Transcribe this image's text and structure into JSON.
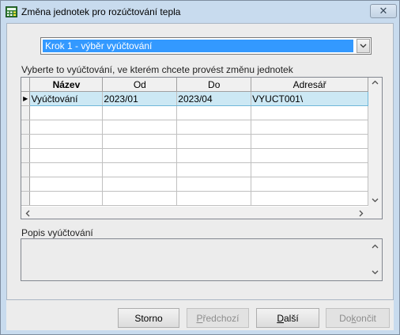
{
  "window": {
    "title": "Změna jednotek pro rozúčtování tepla",
    "close_symbol": "✕"
  },
  "step_combo": {
    "value": "Krok 1 - výběr vyúčtování",
    "arrow": "⌵"
  },
  "grid_label": "Vyberte to vyúčtování, ve kterém chcete provést změnu jednotek",
  "grid": {
    "columns": [
      "Název",
      "Od",
      "Do",
      "Adresář"
    ],
    "rows": [
      {
        "indicator": "▶",
        "cells": [
          "Vyúčtování",
          "2023/01",
          "2023/04",
          "VYUCT001\\"
        ]
      }
    ],
    "empty_rows": 7
  },
  "description_label": "Popis vyúčtování",
  "description_value": "",
  "buttons": {
    "cancel": {
      "label": "Storno",
      "enabled": true
    },
    "previous": {
      "label_pre": "",
      "label_accel": "P",
      "label_post": "ředchozí",
      "enabled": false
    },
    "next": {
      "label_pre": "",
      "label_accel": "D",
      "label_post": "alší",
      "enabled": true
    },
    "finish": {
      "label_pre": "Do",
      "label_accel": "k",
      "label_post": "ončit",
      "enabled": false
    }
  },
  "colors": {
    "selection": "#3399ff",
    "row_highlight": "#cce8f4",
    "titlebar": "#c8dbee"
  }
}
